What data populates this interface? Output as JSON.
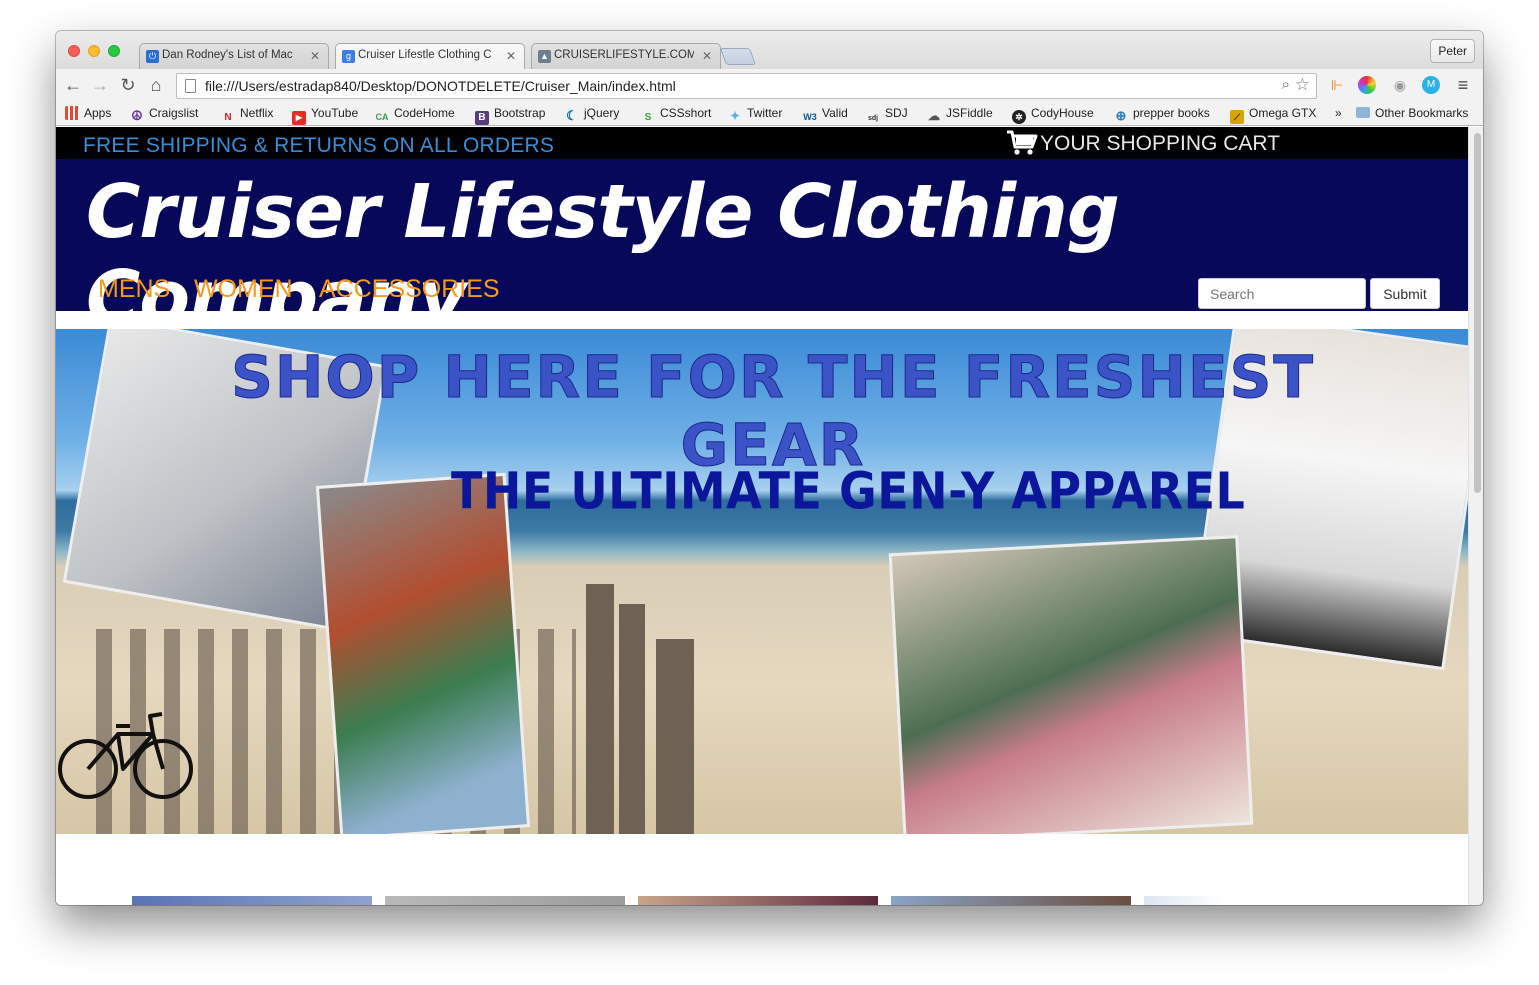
{
  "browser": {
    "tabs": [
      {
        "title": "Dan Rodney's List of Mac",
        "favicon_color": "#2a6fd6",
        "active": false
      },
      {
        "title": "Cruiser Lifestle Clothing C",
        "favicon_color": "#3b7ded",
        "active": true
      },
      {
        "title": "CRUISERLIFESTYLE.COM",
        "favicon_color": "#6a7f8e",
        "active": false
      }
    ],
    "profile_label": "Peter",
    "url": "file:///Users/estradap840/Desktop/DONOTDELETE/Cruiser_Main/index.html",
    "bookmarks": [
      {
        "label": "Apps",
        "icon": "apps-grid-icon",
        "color": "#e04a2f"
      },
      {
        "label": "Craigslist",
        "icon": "peace-icon",
        "color": "#6b2e9c"
      },
      {
        "label": "Netflix",
        "icon": "netflix-icon",
        "color": "#d81f26"
      },
      {
        "label": "YouTube",
        "icon": "youtube-icon",
        "color": "#e52d27"
      },
      {
        "label": "CodeHome",
        "icon": "codehome-icon",
        "color": "#3a9a4a"
      },
      {
        "label": "Bootstrap",
        "icon": "bootstrap-icon",
        "color": "#563d7c"
      },
      {
        "label": "jQuery",
        "icon": "jquery-icon",
        "color": "#0769ad"
      },
      {
        "label": "CSSshort",
        "icon": "css-icon",
        "color": "#3aa13a"
      },
      {
        "label": "Twitter",
        "icon": "twitter-icon",
        "color": "#55acee"
      },
      {
        "label": "Valid",
        "icon": "w3-icon",
        "color": "#005a9c"
      },
      {
        "label": "SDJ",
        "icon": "sdj-icon",
        "color": "#333333"
      },
      {
        "label": "JSFiddle",
        "icon": "cloud-icon",
        "color": "#555555"
      },
      {
        "label": "CodyHouse",
        "icon": "codyhouse-icon",
        "color": "#222222"
      },
      {
        "label": "prepper books",
        "icon": "globe-icon",
        "color": "#2a7fc1"
      },
      {
        "label": "Omega GTX",
        "icon": "chart-icon",
        "color": "#d8a400"
      }
    ],
    "overflow_label": "»",
    "other_bookmarks_label": "Other Bookmarks"
  },
  "site": {
    "promo": "FREE SHIPPING & RETURNS ON ALL ORDERS",
    "cart": "YOUR SHOPPING CART",
    "brand": "Cruiser Lifestyle Clothing Company",
    "nav": [
      "MENS",
      "WOMEN",
      "ACCESSORIES"
    ],
    "search_placeholder": "Search",
    "submit_label": "Submit",
    "hero_headline": "SHOP HERE FOR THE FRESHEST GEAR",
    "hero_subline": "THE ULTIMATE GEN-Y APPAREL"
  },
  "colors": {
    "promo_text": "#3b8cd6",
    "header_bg": "#08085a",
    "nav_link": "#f49a1a",
    "headline": "#3c52c7",
    "subline": "#0b169a"
  }
}
